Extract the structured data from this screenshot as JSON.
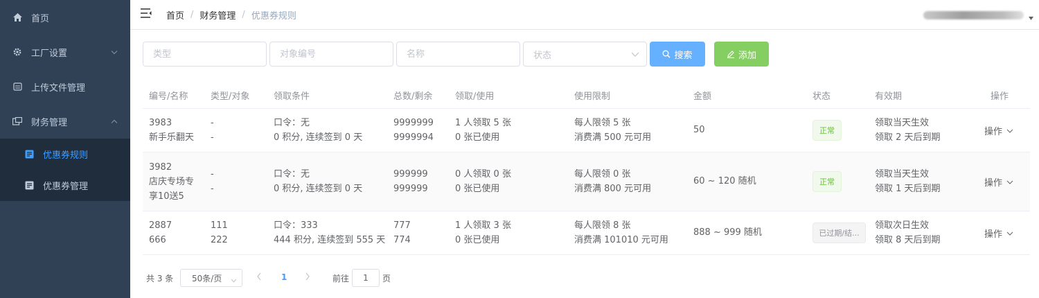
{
  "sidebar": {
    "items": [
      {
        "label": "首页",
        "icon": "home-icon"
      },
      {
        "label": "工厂设置",
        "icon": "gear-icon"
      },
      {
        "label": "上传文件管理",
        "icon": "file-icon"
      },
      {
        "label": "财务管理",
        "icon": "finance-icon"
      }
    ],
    "subitems": [
      {
        "label": "优惠券规则",
        "icon": "coupon-rule-icon",
        "active": true
      },
      {
        "label": "优惠券管理",
        "icon": "coupon-manage-icon",
        "active": false
      }
    ],
    "bg_color": "#304156",
    "active_color": "#409eff"
  },
  "navbar": {
    "breadcrumb": [
      "首页",
      "财务管理",
      "优惠券规则"
    ],
    "separator": "/"
  },
  "filters": {
    "type_placeholder": "类型",
    "target_placeholder": "对象编号",
    "name_placeholder": "名称",
    "status_placeholder": "状态",
    "search_label": "搜索",
    "add_label": "添加"
  },
  "table": {
    "headers": [
      "编号/名称",
      "类型/对象",
      "领取条件",
      "总数/剩余",
      "领取/使用",
      "使用限制",
      "金额",
      "状态",
      "有效期",
      "操作"
    ],
    "rows": [
      {
        "id": "3983",
        "name": "新手乐翻天",
        "type": "-",
        "target": "-",
        "cond1": "口令：无",
        "cond2": "0 积分, 连续签到 0 天",
        "total": "9999999",
        "remain": "9999994",
        "receive": "1 人领取 5 张",
        "used": "0 张已使用",
        "limit1": "每人限领 5 张",
        "limit2": "消费满 500 元可用",
        "amount": "50",
        "status": "正常",
        "valid1": "领取当天生效",
        "valid2": "领取 2 天后到期",
        "op": "操作"
      },
      {
        "id": "3982",
        "name1": "店庆专场专",
        "name2": "享10送5",
        "type": "-",
        "target": "-",
        "cond1": "口令：无",
        "cond2": "0 积分, 连续签到 0 天",
        "total": "999999",
        "remain": "999999",
        "receive": "0 人领取 0 张",
        "used": "0 张已使用",
        "limit1": "每人限领 0 张",
        "limit2": "消费满 800 元可用",
        "amount": "60 ~ 120 随机",
        "status": "正常",
        "valid1": "领取当天生效",
        "valid2": "领取 1 天后到期",
        "op": "操作"
      },
      {
        "id": "2887",
        "name": "666",
        "type": "111",
        "target": "222",
        "cond1": "口令：333",
        "cond2": "444 积分, 连续签到 555 天",
        "total": "777",
        "remain": "774",
        "receive": "1 人领取 3 张",
        "used": "0 张已使用",
        "limit1": "每人限领 8 张",
        "limit2": "消费满 101010 元可用",
        "amount": "888 ~ 999 随机",
        "status": "已过期/结...",
        "valid1": "领取次日生效",
        "valid2": "领取 8 天后到期",
        "op": "操作"
      }
    ]
  },
  "pagination": {
    "total": "共 3 条",
    "page_size": "50条/页",
    "current": "1",
    "goto": "前往",
    "goto_value": "1",
    "page_suffix": "页"
  },
  "colors": {
    "primary": "#409eff",
    "search_button": "#66b1ff",
    "add_button": "#85ce61",
    "success_tag": "#67c23a",
    "info_tag": "#909399"
  }
}
